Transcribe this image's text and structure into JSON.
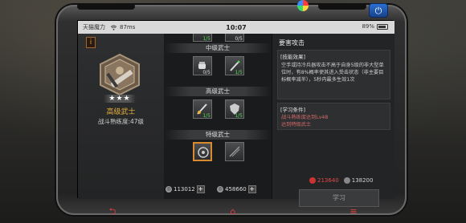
{
  "status": {
    "carrier": "天猫魔力",
    "left_battery": "87ms",
    "clock": "10:07",
    "battery": "89%"
  },
  "left": {
    "info_label": "i",
    "stars": "★★★",
    "rank_name": "高级武士",
    "mastery": "战斗熟练度:47级"
  },
  "tiers": [
    {
      "name": "中级武士",
      "skills": [
        {
          "lv": "0/5"
        },
        {
          "lv": "1/5"
        }
      ]
    },
    {
      "name": "高级武士",
      "skills": [
        {
          "lv": "1/5"
        },
        {
          "lv": "1/5"
        }
      ]
    },
    {
      "name": "特级武士",
      "skills": [
        {
          "lv": ""
        },
        {
          "lv": ""
        }
      ]
    }
  ],
  "top_partial": {
    "lv_a": "1/5",
    "lv_b": "0/5"
  },
  "detail": {
    "title": "要害攻击",
    "effect_head": "[技能效果]",
    "effect_text": "空手或持冷兵器攻击不高于自身5级的非大型单位时，有8%概率使其进入受击状态（非主要目标概率减半），5秒内最多生效1次",
    "req_head": "[学习条件]",
    "req_line1": "战斗熟练度达到Lv48",
    "req_line2": "达到特级武士",
    "cost_gold": "213640",
    "cost_silver": "138200",
    "learn_label": "学习"
  },
  "resources": {
    "a": "113012",
    "b": "458660"
  },
  "colors": {
    "accent": "#d88a2e",
    "gold": "#e8b23a",
    "red": "#e04a4a",
    "green": "#5bdc5b"
  }
}
